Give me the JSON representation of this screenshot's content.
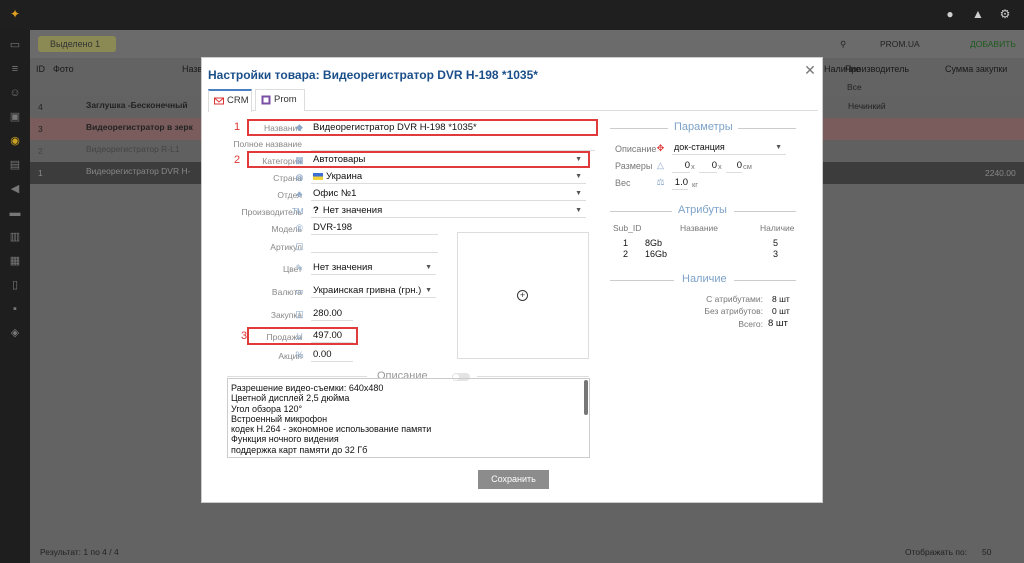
{
  "background": {
    "filter_chip": "Выделено 1",
    "headers": [
      "ID",
      "Фото",
      "Назв",
      "Наличие",
      "Производитель",
      "Сумма закупки"
    ],
    "filter_all": "Все",
    "producer_value": "Нечинкий",
    "rows": [
      {
        "id": "4",
        "name": "Заглушка -Бесконечный"
      },
      {
        "id": "3",
        "name": "Видеорегистратор в зерк"
      },
      {
        "id": "2",
        "name": "Видеорегистратор R-L1"
      },
      {
        "id": "1",
        "name": "Видеорегистратор DVR H-",
        "sum": "2240.00"
      }
    ],
    "footer_result": "Результат: 1 по 4 / 4",
    "footer_show": "Отображать по:",
    "footer_count": "50",
    "add_button": "ДОБАВИТЬ",
    "prom_button": "PROM.UA"
  },
  "modal": {
    "title": "Настройки товара: Видеорегистратор DVR H-198 *1035*",
    "tabs": [
      "CRM",
      "Prom"
    ],
    "fields": {
      "name": {
        "label": "Название",
        "value": "Видеорегистратор DVR H-198 *1035*"
      },
      "full_name": {
        "label": "Полное название",
        "value": ""
      },
      "category": {
        "label": "Категория",
        "value": "Автотовары"
      },
      "country": {
        "label": "Страна",
        "value": "Украина"
      },
      "department": {
        "label": "Отдел",
        "value": "Офис №1"
      },
      "manufacturer": {
        "label": "Производитель",
        "value": "Нет значения"
      },
      "model": {
        "label": "Модель",
        "value": "DVR-198"
      },
      "article": {
        "label": "Артикул",
        "value": ""
      },
      "color": {
        "label": "Цвет",
        "value": "Нет значения"
      },
      "currency": {
        "label": "Валюта",
        "value": "Украинская гривна (грн.)"
      },
      "purchase": {
        "label": "Закупка",
        "value": "280.00"
      },
      "sale": {
        "label": "Продажа",
        "value": "497.00"
      },
      "discount": {
        "label": "Акция",
        "value": "0.00"
      }
    },
    "annotations": [
      "1",
      "2",
      "3"
    ],
    "description": {
      "title": "Описание",
      "lines": [
        "Разрешение видео-съемки: 640x480",
        "Цветной дисплей 2,5 дюйма",
        "Угол обзора 120°",
        "Встроенный микрофон",
        "кодек H.264 - экономное использование памяти",
        "Функция ночного видения",
        "поддержка карт памяти до 32 Гб"
      ]
    },
    "save_button": "Сохранить",
    "params": {
      "title": "Параметры",
      "desc_label": "Описание",
      "desc_value": "док-станция",
      "sizes_label": "Размеры",
      "size_x": "0",
      "size_y": "0",
      "size_z": "0",
      "x_sep": "x",
      "unit_cm": "см",
      "weight_label": "Вес",
      "weight_value": "1.0",
      "unit_kg": "кг"
    },
    "attributes": {
      "title": "Атрибуты",
      "headers": [
        "Sub_ID",
        "Название",
        "Наличие"
      ],
      "rows": [
        {
          "id": "1",
          "name": "8Gb",
          "qty": "5"
        },
        {
          "id": "2",
          "name": "16Gb",
          "qty": "3"
        }
      ]
    },
    "stock": {
      "title": "Наличие",
      "with_attr_label": "С атрибутами:",
      "with_attr_value": "8 шт",
      "without_attr_label": "Без атрибутов:",
      "without_attr_value": "0 шт",
      "total_label": "Всего:",
      "total_value": "8 шт"
    }
  },
  "colors": {
    "accent": "#1b4f8a",
    "highlight": "#e03a3a",
    "section": "#7da2c8"
  }
}
